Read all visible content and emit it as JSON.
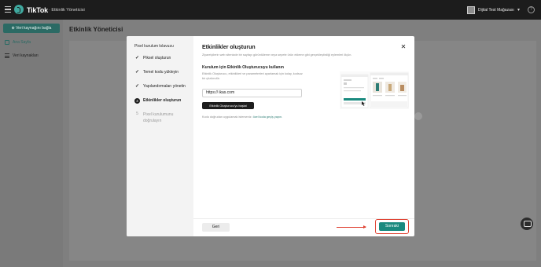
{
  "topbar": {
    "brand": "TikTok",
    "subtitle": "· Etkinlik Yöneticisi",
    "store_name": "Dijital Test Mağazası"
  },
  "sidebar": {
    "cta_label": "⊕ Veri kaynağını bağla",
    "items": [
      {
        "label": "Ana Sayfa",
        "icon": "home-icon",
        "active": true
      },
      {
        "label": "Veri kaynakları",
        "icon": "list-icon",
        "active": false
      }
    ]
  },
  "page": {
    "title": "Etkinlik Yöneticisi"
  },
  "modal": {
    "guide_title": "Pixel kurulum kılavuzu",
    "steps": [
      {
        "label": "Piksel oluşturun",
        "state": "done"
      },
      {
        "label": "Temel kodu yükleyin",
        "state": "done"
      },
      {
        "label": "Yapılandırmaları yönetin",
        "state": "done"
      },
      {
        "number": "4",
        "label": "Etkinlikler oluşturun",
        "state": "active"
      },
      {
        "number": "5",
        "label": "Pixel kurulumunu doğrulayın",
        "state": "idle"
      }
    ],
    "title": "Etkinlikler oluşturun",
    "description": "Ziyaretçilerin web sitenizde bir sayfayı görüntüleme veya sepete ürün ekleme gibi gerçekleştirdiği eylemleri ölçün.",
    "section_title": "Kurulum için Etkinlik Oluşturucuyu kullanın",
    "section_desc": "Etkinlik Oluşturucu, etkinlikleri ve parametreleri ayarlamak için kolay, kodsuz bir çözümdür.",
    "url_value": "https:// ikas.com",
    "builder_button": "Etkinlik Oluşturucu'yu başlat",
    "manual_text": "Kodu doğrudan uygulamak isterseniz:",
    "manual_link": "özel koda geçiş yapın.",
    "back_label": "Geri",
    "next_label": "Sonraki"
  },
  "colors": {
    "accent": "#1a8a7f",
    "highlight": "#e04434",
    "topbar": "#1c1c1c"
  }
}
